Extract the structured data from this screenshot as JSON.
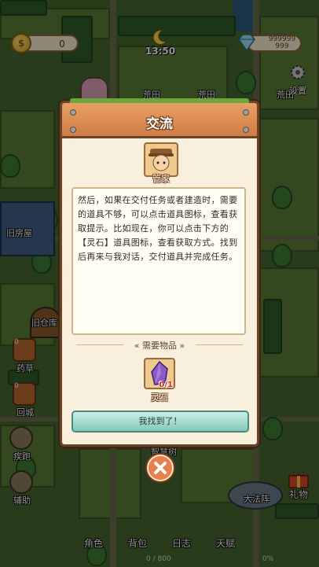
{
  "hud": {
    "coins": "0",
    "time": "13:50",
    "gems_line1": "999999",
    "gems_line2": "999",
    "settings_label": "设置"
  },
  "map_labels": {
    "field1": "荒田",
    "field2": "荒田",
    "field3": "荒田",
    "old_house": "旧房屋",
    "old_warehouse": "旧仓库",
    "wisdom_tree": "智慧树",
    "formation": "大法阵"
  },
  "side_tools": [
    {
      "label": "药草",
      "count": "0"
    },
    {
      "label": "回城",
      "count": "0"
    },
    {
      "label": "疾跑"
    },
    {
      "label": "辅助"
    }
  ],
  "dialog": {
    "title": "交流",
    "npc_name": "管家",
    "message": "然后，如果在交付任务或者建造时，需要的道具不够，可以点击道具图标，查看获取提示。比如现在，你可以点击下方的【灵石】道具图标，查看获取方式。找到后再来与我对话，交付道具并完成任务。",
    "required_title": "« 需要物品 »",
    "item_name": "灵石",
    "item_count": "0/1",
    "confirm_label": "我找到了！"
  },
  "bottom_nav": {
    "items": [
      "角色",
      "背包",
      "日志",
      "天赋"
    ],
    "exp": "0 / 800",
    "exp_percent": "0%"
  },
  "gift_label": "礼物",
  "colors": {
    "dialog_bg": "#f8f0dc",
    "header": "#cf7c45",
    "confirm": "#86c9b9",
    "close": "#e97f4c"
  }
}
